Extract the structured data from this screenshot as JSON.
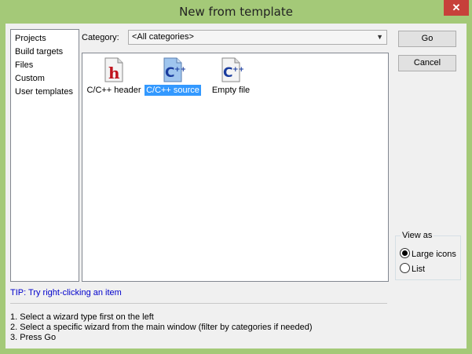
{
  "window": {
    "title": "New from template",
    "close_label": "✕"
  },
  "left_list": {
    "items": [
      "Projects",
      "Build targets",
      "Files",
      "Custom",
      "User templates"
    ]
  },
  "category": {
    "label": "Category:",
    "value": "<All categories>"
  },
  "templates": [
    {
      "label": "C/C++ header",
      "icon": "header-file-icon",
      "selected": false
    },
    {
      "label": "C/C++ source",
      "icon": "source-file-icon",
      "selected": true
    },
    {
      "label": "Empty file",
      "icon": "empty-file-icon",
      "selected": false
    }
  ],
  "buttons": {
    "go": "Go",
    "cancel": "Cancel"
  },
  "view_as": {
    "legend": "View as",
    "large_icons": "Large icons",
    "list": "List",
    "selected": "Large icons"
  },
  "tip": "TIP: Try right-clicking an item",
  "steps": [
    "1. Select a wizard type first on the left",
    "2. Select a specific wizard from the main window (filter by categories if needed)",
    "3. Press Go"
  ],
  "colors": {
    "title_bar": "#a4c978",
    "selection": "#3399ff",
    "tip_text": "#0000cc",
    "close": "#c7403a"
  }
}
